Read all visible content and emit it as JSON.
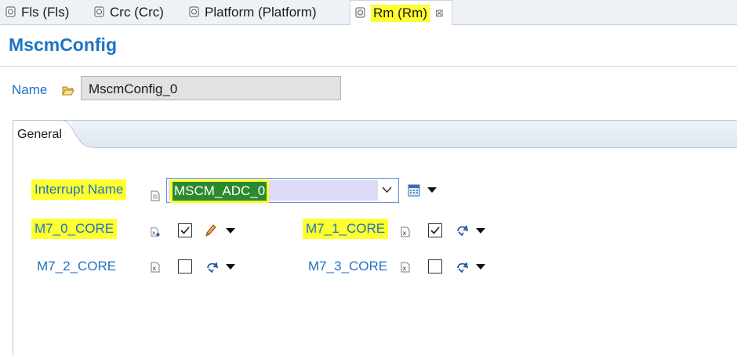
{
  "tabs": [
    {
      "label": "Fls (Fls)",
      "active": false,
      "highlighted": false
    },
    {
      "label": "Crc (Crc)",
      "active": false,
      "highlighted": false
    },
    {
      "label": "Platform (Platform)",
      "active": false,
      "highlighted": false
    },
    {
      "label": "Rm (Rm)",
      "active": true,
      "highlighted": true,
      "close_glyph": "⊠"
    }
  ],
  "page": {
    "title": "MscmConfig"
  },
  "name_row": {
    "label": "Name",
    "value": "MscmConfig_0",
    "icon": "folder-open-icon"
  },
  "folder": {
    "tab_label": "General"
  },
  "fields": {
    "interrupt_name": {
      "label": "Interrupt Name",
      "value": "MSCM_ADC_0",
      "highlighted": true
    },
    "m7_0_core": {
      "label": "M7_0_CORE",
      "checked": true,
      "highlighted": true,
      "action_icon": "pencil-icon"
    },
    "m7_1_core": {
      "label": "M7_1_CORE",
      "checked": true,
      "highlighted": true,
      "action_icon": "default-value-icon"
    },
    "m7_2_core": {
      "label": "M7_2_CORE",
      "checked": false,
      "highlighted": false,
      "action_icon": "default-value-icon"
    },
    "m7_3_core": {
      "label": "M7_3_CORE",
      "checked": false,
      "highlighted": false,
      "action_icon": "default-value-icon"
    }
  },
  "colors": {
    "accent": "#1f73c4",
    "highlight": "#ffff2e",
    "selection_green": "#2b8a2d"
  }
}
